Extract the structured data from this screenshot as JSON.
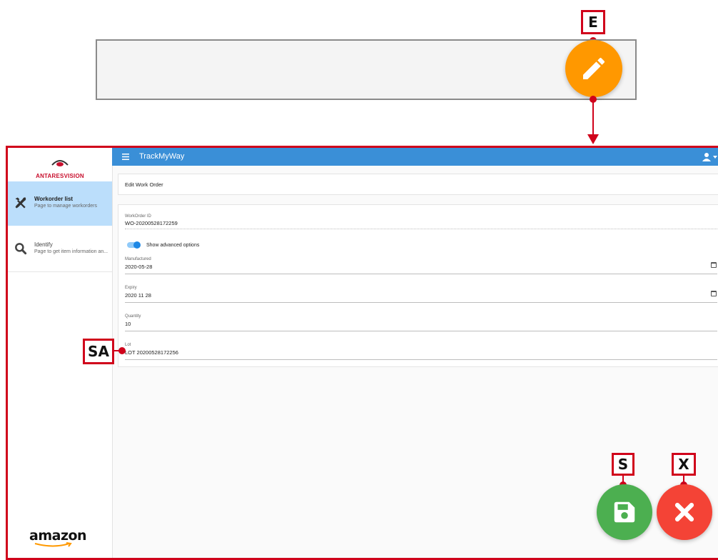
{
  "callouts": {
    "e": "E",
    "s": "S",
    "x": "X",
    "sa": "SA"
  },
  "icons": {
    "fab_edit": "pencil-icon",
    "fab_save": "floppy-disk-icon",
    "fab_cancel": "close-icon"
  },
  "colors": {
    "accent_orange": "#ff9800",
    "topbar_blue": "#3a8fd7",
    "save_green": "#4caf50",
    "cancel_red": "#f44336",
    "callout_red": "#d0021b"
  },
  "sidebar": {
    "logo_text": "ANTARESVISION",
    "items": [
      {
        "label": "Workorder list",
        "subtitle": "Page to manage workorders",
        "icon": "tools-icon",
        "active": true
      },
      {
        "label": "Identify",
        "subtitle": "Page to get item information an...",
        "icon": "search-icon",
        "active": false
      }
    ],
    "footer_logo": "amazon"
  },
  "topbar": {
    "title": "TrackMyWay",
    "menu_icon": "hamburger-icon",
    "user_icon": "user-icon"
  },
  "header_card": {
    "title": "Edit Work Order"
  },
  "form": {
    "workorder_id": {
      "label": "WorkOrder ID",
      "value": "WO-20200528172259"
    },
    "toggle": {
      "label": "Show advanced options",
      "on": true
    },
    "manufactured": {
      "label": "Manufactured",
      "value": "2020-05-28"
    },
    "expiry": {
      "label": "Expiry",
      "value": "2020 11 28"
    },
    "quantity": {
      "label": "Quantity",
      "value": "10"
    },
    "lot": {
      "label": "Lot",
      "value": "LOT 20200528172256"
    }
  }
}
